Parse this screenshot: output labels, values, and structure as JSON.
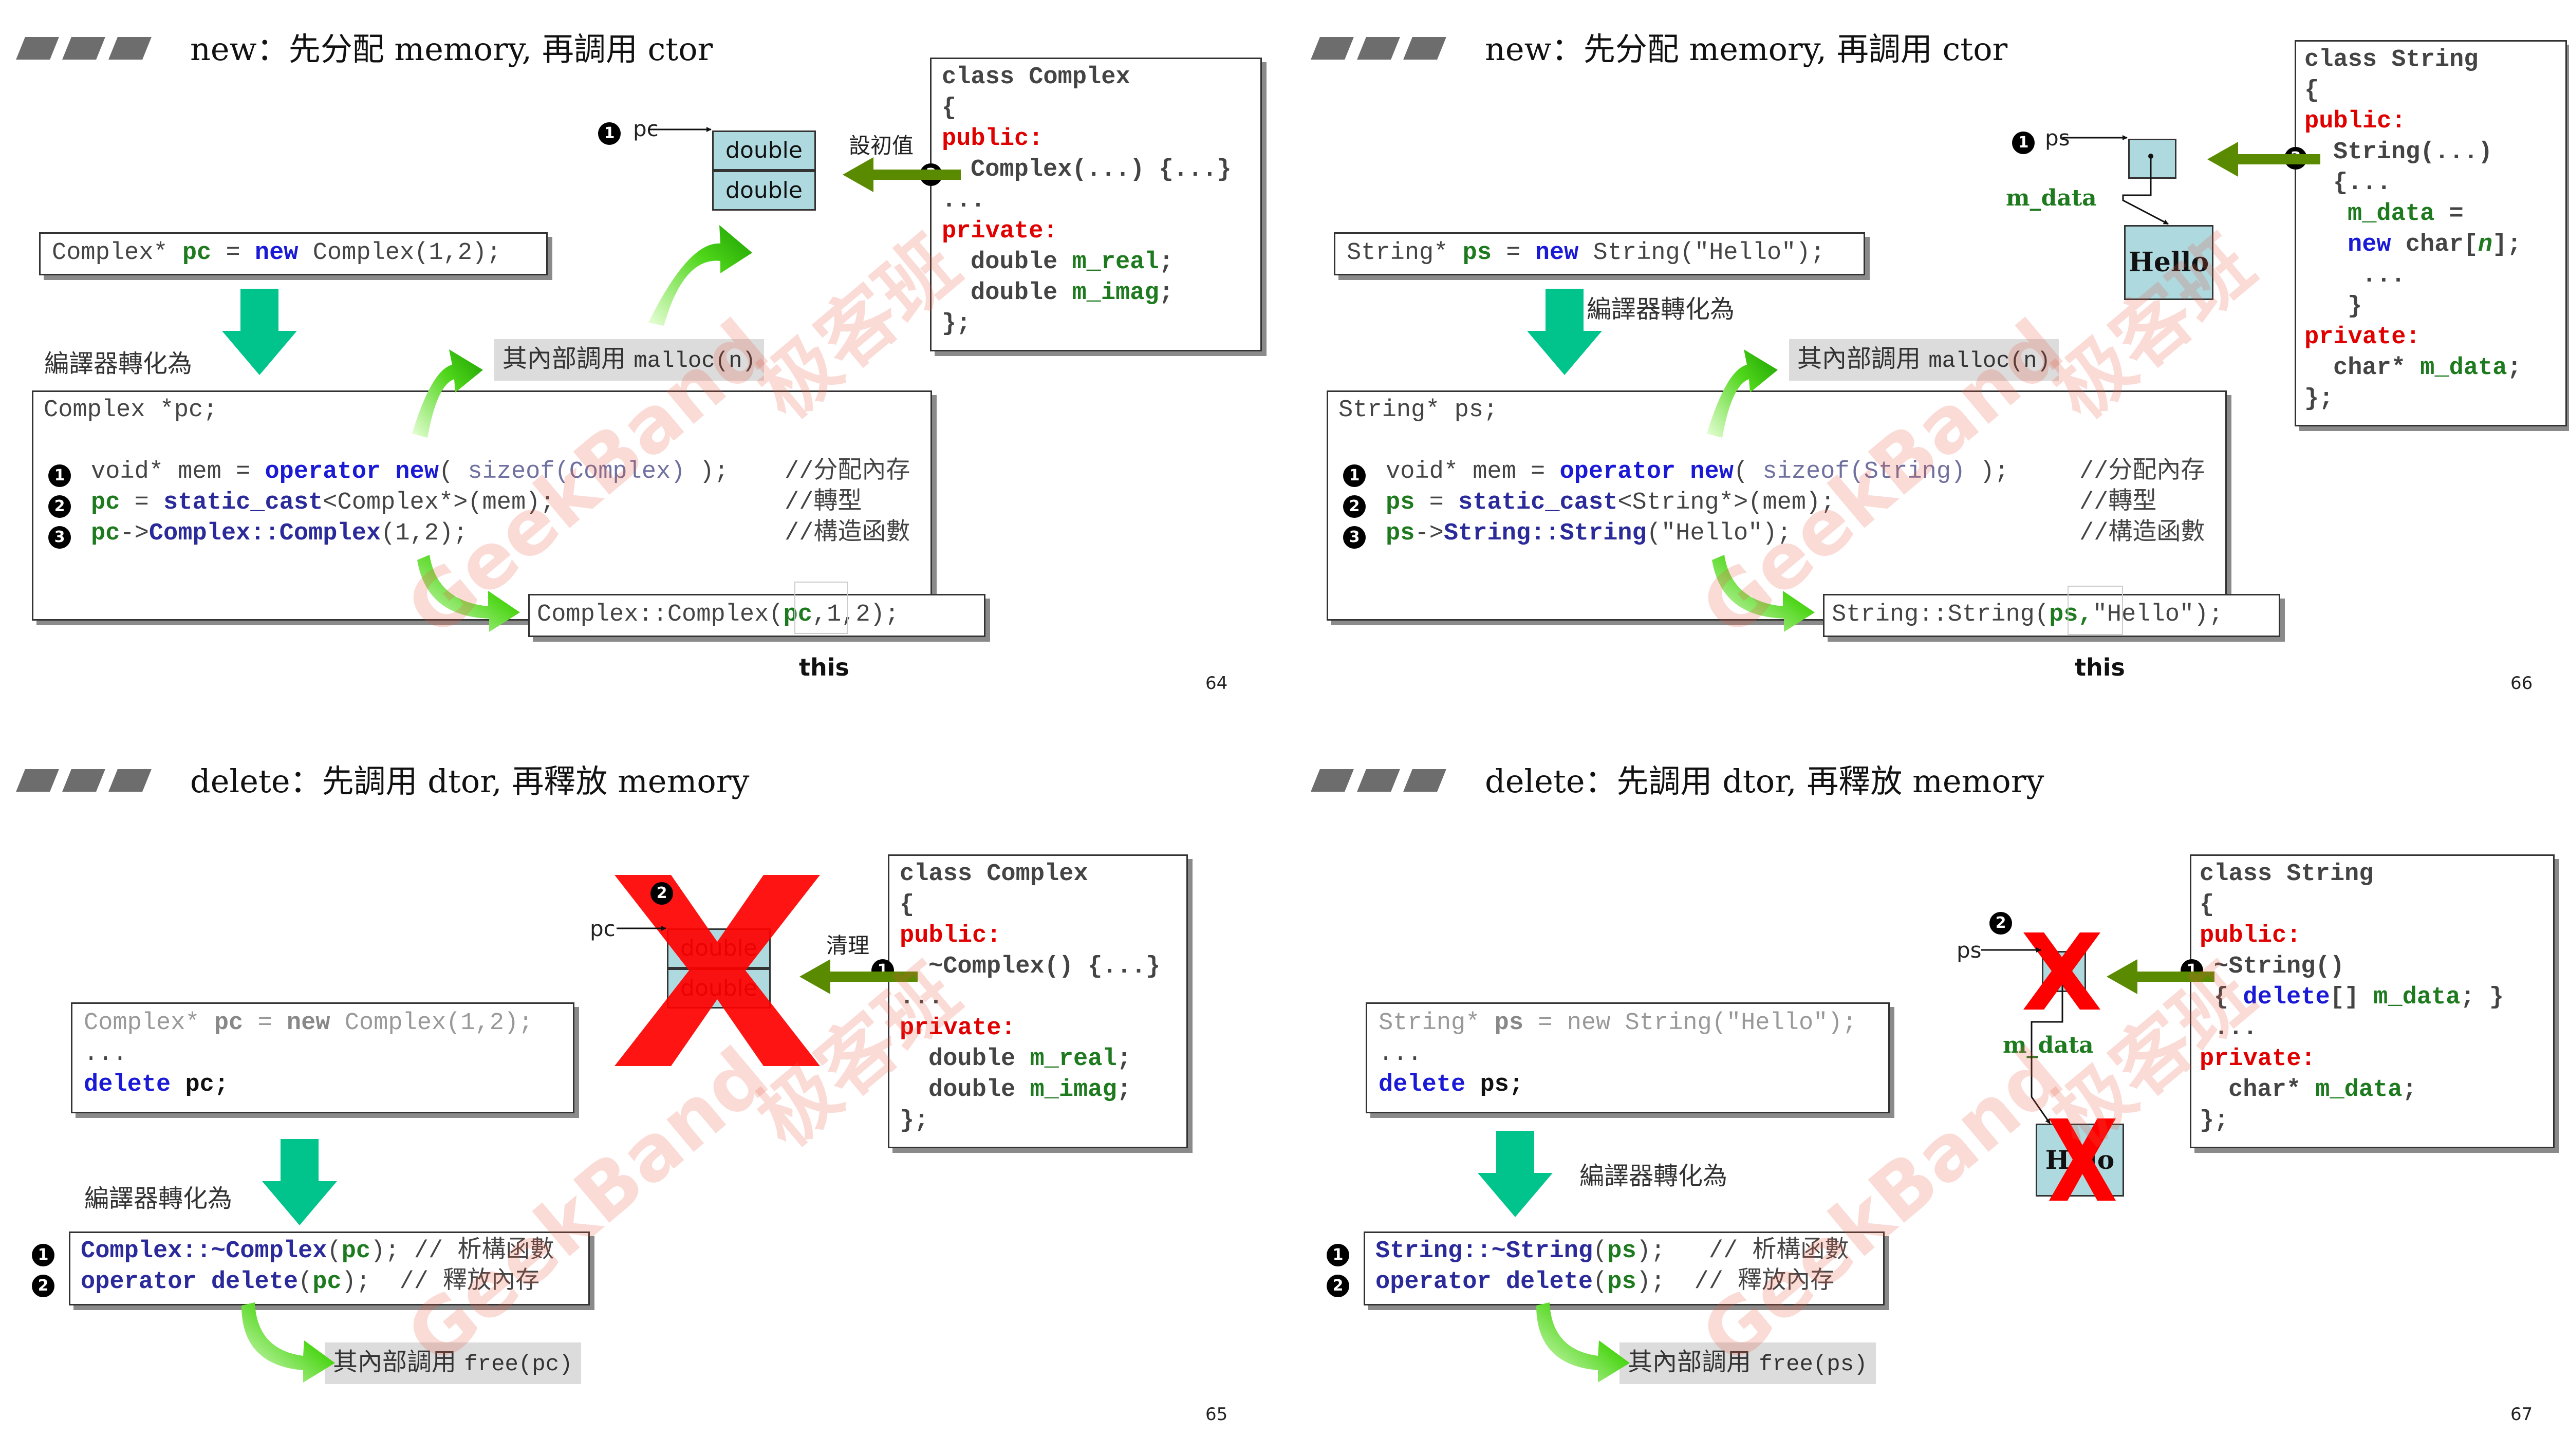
{
  "colors": {
    "keyword": "#1a1ad6",
    "access": "#e00000",
    "member": "#1e7a1e",
    "arrow_green": "#5a8a00",
    "cell_fill": "#aed9df",
    "x_mark": "#ff0000",
    "down_arrow": "#00c48c"
  },
  "watermark": {
    "brand": "GeekBand",
    "cn": "极客班"
  },
  "icons": {
    "curved_arrow": "green-curved-arrow-icon",
    "left_arrow": "green-left-arrow-icon",
    "down_arrow": "teal-down-arrow-icon",
    "delete_mark": "red-x-icon"
  },
  "s64": {
    "title": "new：先分配 memory, 再調用 ctor",
    "stmt_pre": "Complex* ",
    "stmt_pc": "pc",
    "stmt_eq": " = ",
    "stmt_new": "new",
    "stmt_post": " Complex(1,2);",
    "convert": "編譯器轉化為",
    "code_l1": "Complex *pc;",
    "mem_a": "void* mem = ",
    "mem_op": "operator new",
    "mem_b": "( ",
    "mem_sz": "sizeof(Complex)",
    "mem_c": " ); ",
    "cast_pc": "pc",
    "cast_a": " = ",
    "cast_sc": "static_cast",
    "cast_b": "<Complex*>(mem);",
    "ctor_pc": "pc",
    "ctor_arrow": "->",
    "ctor_name": "Complex::Complex",
    "ctor_args": "(1,2);",
    "c1": "//分配內存",
    "c2": "//轉型",
    "c3": "//構造函數",
    "malloc_label": "其內部調用 ",
    "malloc_code": "malloc(n)",
    "call_a": "Complex::Complex(",
    "call_pc": "pc",
    "call_b": ",1,2);",
    "this_label": "this",
    "ptr_label": "pc",
    "cell1": "double",
    "cell2": "double",
    "init_label": "設初值",
    "cls1": "class Complex",
    "cls2": "{",
    "cls3": "public:",
    "cls4": "Complex(...) {...}",
    "cls5": "...",
    "cls6": "private:",
    "cls7a": "double ",
    "cls7b": "m_real",
    "cls7c": ";",
    "cls8a": "double ",
    "cls8b": "m_imag",
    "cls8c": ";",
    "cls9": "};",
    "page": "64"
  },
  "s66": {
    "title": "new：先分配 memory, 再調用 ctor",
    "stmt_pre": "String* ",
    "stmt_ps": "ps",
    "stmt_eq": " = ",
    "stmt_new": "new",
    "stmt_post": " String(\"Hello\");",
    "convert": "編譯器轉化為",
    "code_l1": "String* ps;",
    "mem_a": "void* mem = ",
    "mem_op": "operator new",
    "mem_b": "( ",
    "mem_sz": "sizeof(String)",
    "mem_c": " ); ",
    "cast_ps": "ps",
    "cast_a": " = ",
    "cast_sc": "static_cast",
    "cast_b": "<String*>(mem);",
    "ctor_ps": "ps",
    "ctor_arrow": "->",
    "ctor_name": "String::String",
    "ctor_args": "(\"Hello\");",
    "c1": "//分配內存",
    "c2": "//轉型",
    "c3": "//構造函數",
    "malloc_label": "其內部調用 ",
    "malloc_code": "malloc(n)",
    "call_a": "String::String(",
    "call_ps": "ps,",
    "call_b": "\"Hello\");",
    "this_label": "this",
    "ptr_label": "ps",
    "mdata_label": "m_data",
    "hello": "Hello",
    "cls1": "class String",
    "cls2": "{",
    "cls3": "public:",
    "cls4": "String(...)",
    "cls5": "{...",
    "cls6a": "m_data",
    "cls6b": " =",
    "cls7a": "new",
    "cls7b": " char[",
    "cls7c": "n",
    "cls7d": "];",
    "cls8": "...",
    "cls9": "}",
    "cls10": "private:",
    "cls11a": "char* ",
    "cls11b": "m_data",
    "cls11c": ";",
    "cls12": "};",
    "page": "66"
  },
  "s65": {
    "title": "delete：先調用 dtor, 再釋放 memory",
    "g1a": "Complex* ",
    "g1b": "pc",
    "g1c": " = ",
    "g1d": "new",
    "g1e": " Complex(1,2);",
    "g2": "...",
    "del_kw": "delete",
    "del_var": " pc;",
    "convert": "編譯器轉化為",
    "r1a": "Complex::~Complex",
    "r1b": "(",
    "r1c": "pc",
    "r1d": ");",
    "r1e": " // 析構函數",
    "r2a": "operator delete",
    "r2b": "(",
    "r2c": "pc",
    "r2d": ");",
    "r2e": "  // 釋放內存",
    "free_label": "其內部調用 ",
    "free_code": "free(pc)",
    "ptr_label": "pc",
    "cell1": "double",
    "cell2": "double",
    "clean_label": "清理",
    "cls1": "class Complex",
    "cls2": "{",
    "cls3": "public:",
    "cls4": "~Complex() {...}",
    "cls5": "...",
    "cls6": "private:",
    "cls7a": "double ",
    "cls7b": "m_real",
    "cls7c": ";",
    "cls8a": "double ",
    "cls8b": "m_imag",
    "cls8c": ";",
    "cls9": "};",
    "page": "65"
  },
  "s67": {
    "title": "delete：先調用 dtor, 再釋放 memory",
    "g1a": "String* ",
    "g1b": "ps",
    "g1c": " = ",
    "g1d": "new",
    "g1e": " String(\"Hello\");",
    "g2": "...",
    "del_kw": "delete",
    "del_var": " ps;",
    "convert": "編譯器轉化為",
    "r1a": "String::~String",
    "r1b": "(",
    "r1c": "ps",
    "r1d": ");",
    "r1e": "   // 析構函數",
    "r2a": "operator delete",
    "r2b": "(",
    "r2c": "ps",
    "r2d": ");",
    "r2e": "  // 釋放內存",
    "free_label": "其內部調用 ",
    "free_code": "free(ps)",
    "ptr_label": "ps",
    "mdata_label": "m_data",
    "hello_partial": "H  lo",
    "cls1": "class String",
    "cls2": "{",
    "cls3": "public:",
    "cls4": "~String()",
    "cls5a": "{ ",
    "cls5b": "delete",
    "cls5c": "[] ",
    "cls5d": "m_data",
    "cls5e": "; }",
    "cls6": "...",
    "cls7": "private:",
    "cls8a": "char* ",
    "cls8b": "m_data",
    "cls8c": ";",
    "cls9": "};",
    "page": "67"
  }
}
